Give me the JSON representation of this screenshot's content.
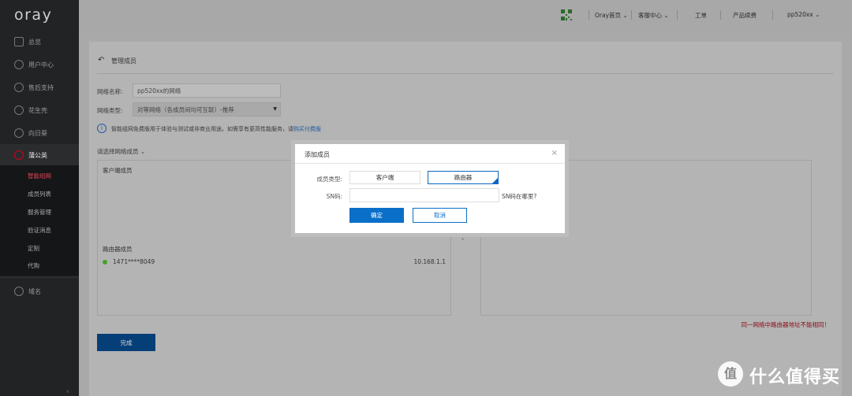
{
  "brand": {
    "logo": "oray"
  },
  "sidebar": {
    "items": [
      {
        "label": "总览",
        "icon": "grid-icon"
      },
      {
        "label": "用户中心",
        "icon": "user-icon"
      },
      {
        "label": "售后支持",
        "icon": "headset-icon"
      },
      {
        "label": "花生壳",
        "icon": "peanut-icon"
      },
      {
        "label": "向日葵",
        "icon": "sunflower-icon"
      },
      {
        "label": "蒲公英",
        "icon": "dandelion-icon"
      }
    ],
    "sub_items": [
      {
        "label": "智能组网",
        "active": true
      },
      {
        "label": "成员列表",
        "active": false
      },
      {
        "label": "服务管理",
        "active": false
      },
      {
        "label": "验证消息",
        "active": false
      },
      {
        "label": "定制",
        "active": false
      },
      {
        "label": "代购",
        "active": false
      }
    ],
    "domain_item": {
      "label": "域名",
      "icon": "www-icon"
    }
  },
  "topbar": {
    "home": "Oray首页",
    "service": "客服中心",
    "ticket": "工单",
    "renew": "产品续费",
    "user": "pp520xx"
  },
  "panel": {
    "title": "管理成员",
    "network_name_label": "网络名称:",
    "network_name_value": "pp520xx的网络",
    "network_type_label": "网络类型:",
    "network_type_value": "对等网络（各成员间均可互联）-推荐",
    "info_text": "智能组网免费版用于体验与测试或非商业用途。如需享有更高性能服务，请",
    "info_link": "购买付费版",
    "select_members_label": "请选择网络成员",
    "client_members_label": "客户端成员",
    "router_members_label": "路由器成员",
    "router_member": {
      "name": "1471****8049",
      "ip": "10.168.1.1"
    },
    "warning": "同一网络中路由器地址不能相同！",
    "done_button": "完成"
  },
  "modal": {
    "title": "添加成员",
    "type_label": "成员类型:",
    "type_options": [
      "客户端",
      "路由器"
    ],
    "selected_type": "路由器",
    "sn_label": "SN码:",
    "sn_value": "",
    "sn_help": "SN码在哪里?",
    "ok_button": "确定",
    "cancel_button": "取消"
  },
  "watermark": {
    "text": "什么值得买",
    "logo_char": "值"
  },
  "colors": {
    "accent": "#0a6fc9",
    "active_sidebar": "#e0455a",
    "warning": "#8a0a16",
    "done_button": "#063f77"
  }
}
